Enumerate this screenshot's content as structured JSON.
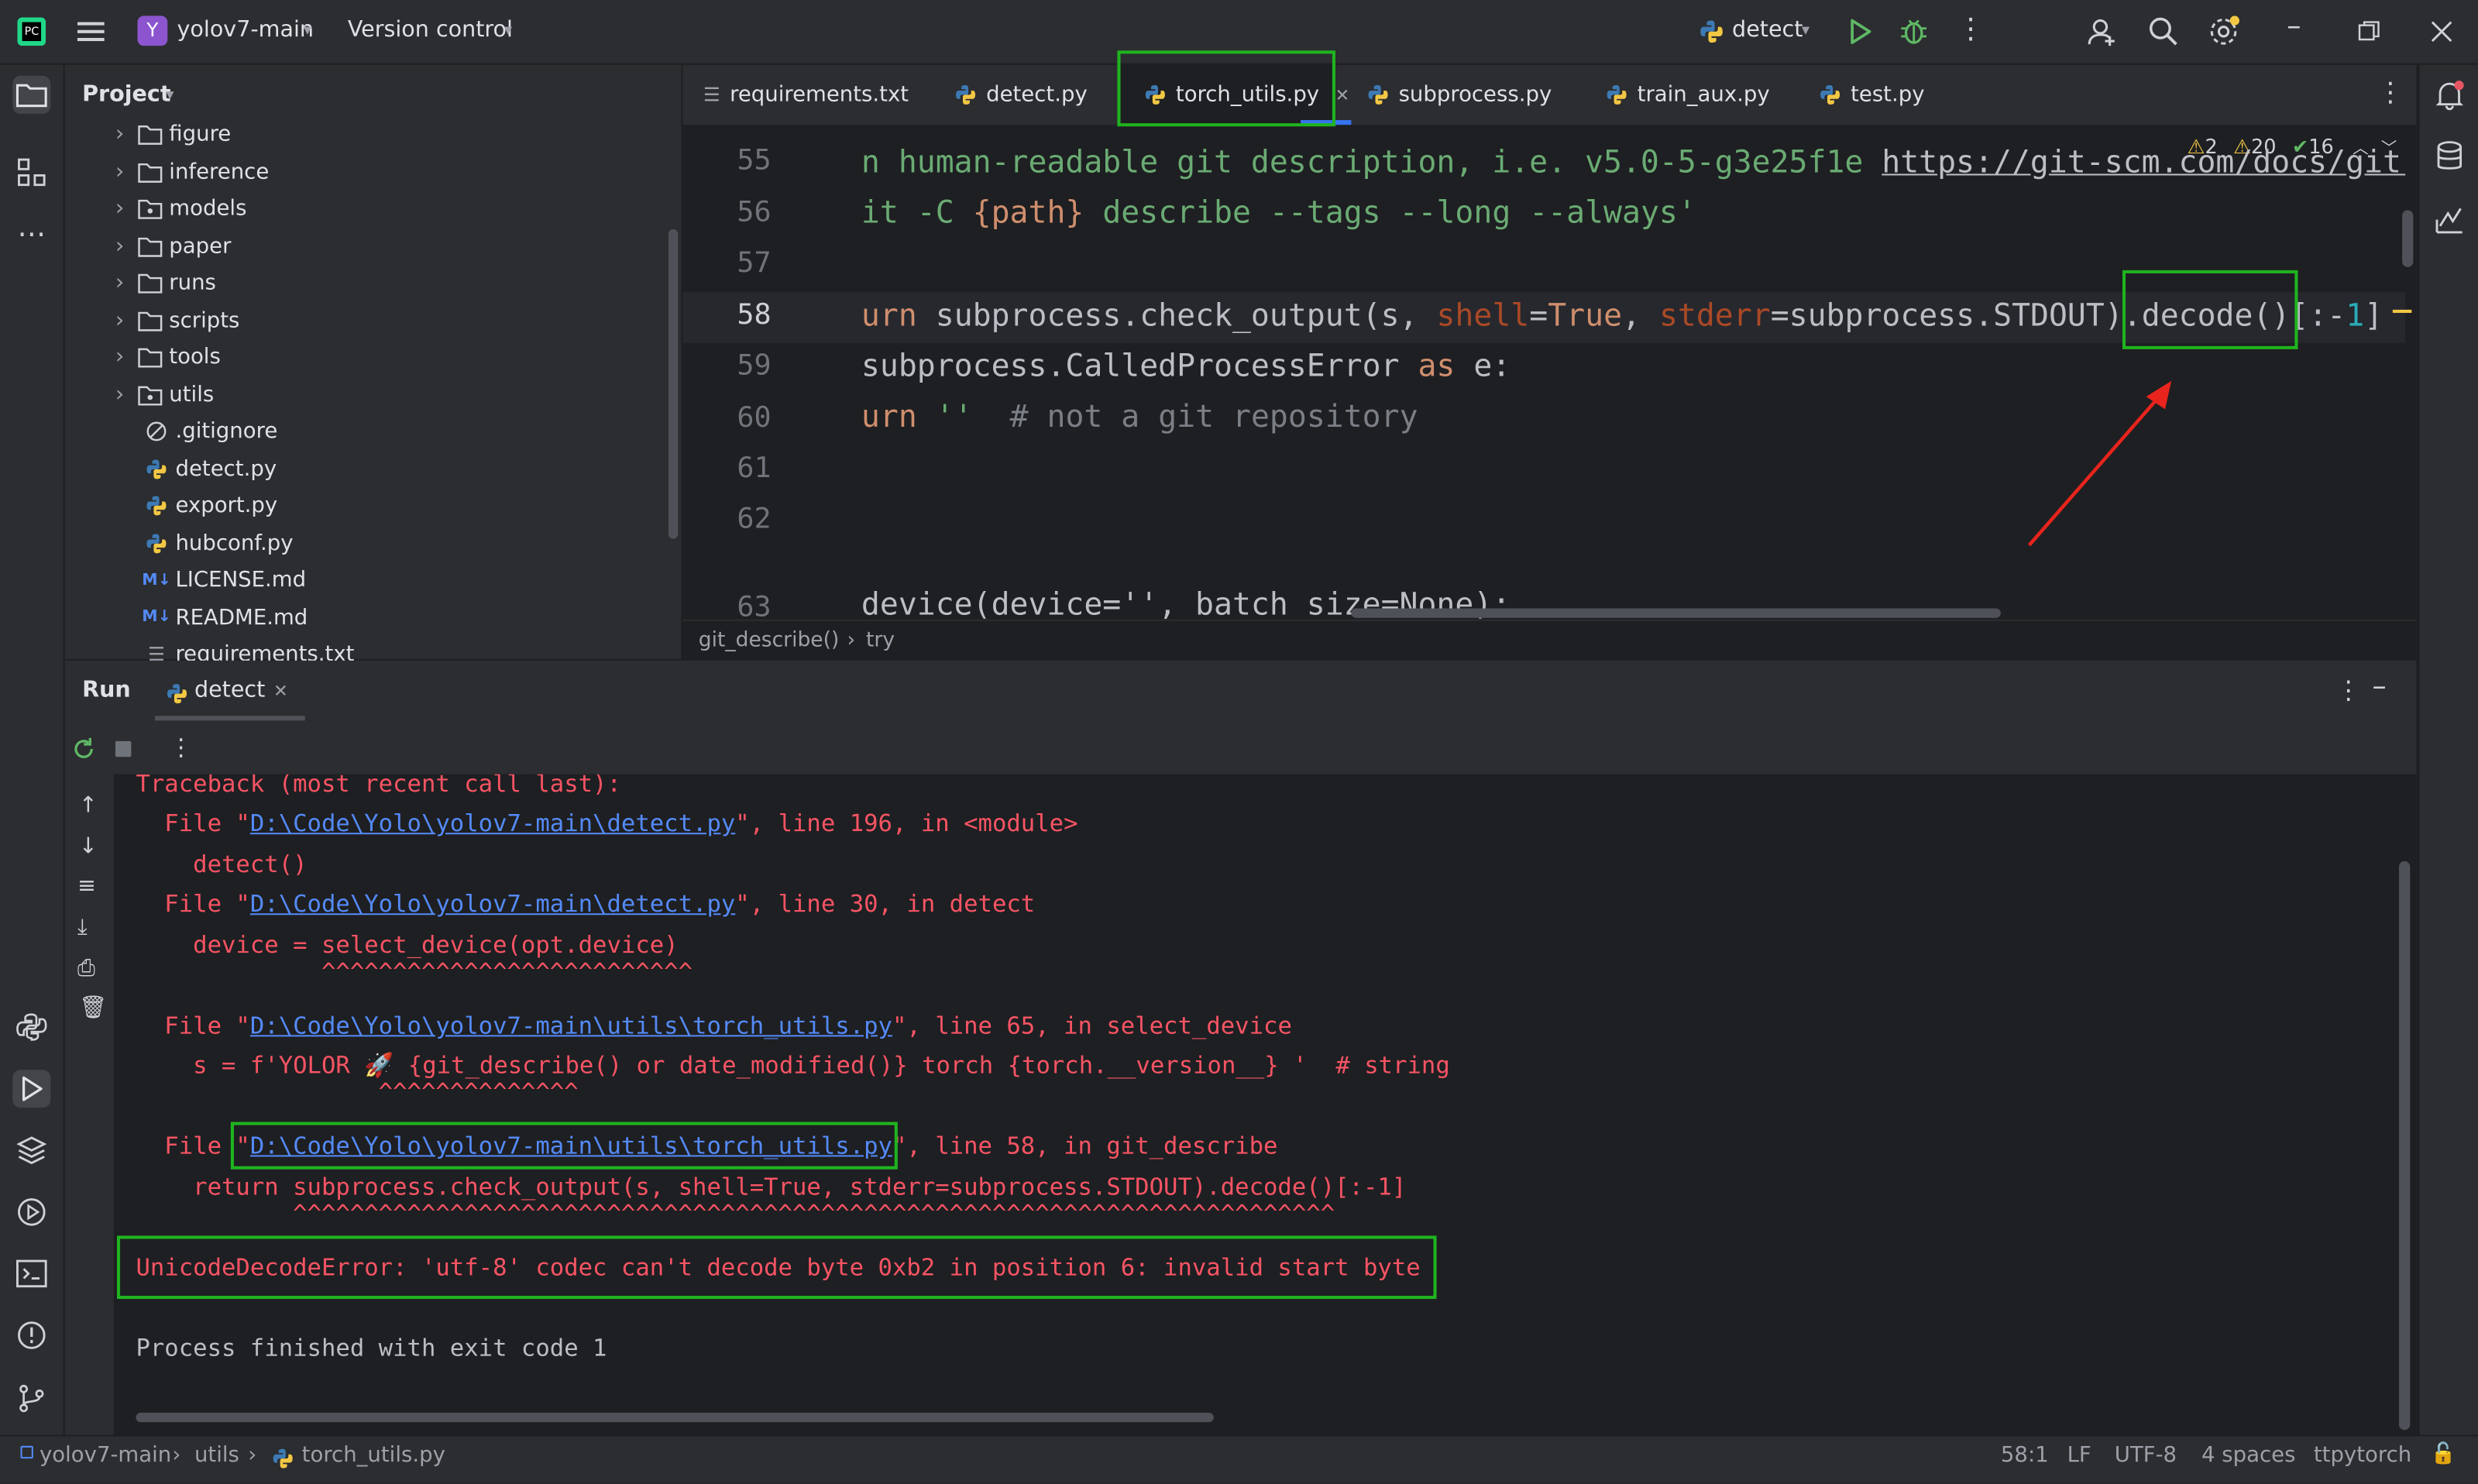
{
  "titlebar": {
    "project_badge": "Y",
    "project_name": "yolov7-main",
    "vcs": "Version control",
    "run_config": "detect"
  },
  "project_panel": {
    "title": "Project",
    "items": [
      {
        "name": "figure",
        "type": "folder"
      },
      {
        "name": "inference",
        "type": "folder"
      },
      {
        "name": "models",
        "type": "package"
      },
      {
        "name": "paper",
        "type": "folder"
      },
      {
        "name": "runs",
        "type": "folder"
      },
      {
        "name": "scripts",
        "type": "folder"
      },
      {
        "name": "tools",
        "type": "folder"
      },
      {
        "name": "utils",
        "type": "package"
      },
      {
        "name": ".gitignore",
        "type": "ignore"
      },
      {
        "name": "detect.py",
        "type": "python"
      },
      {
        "name": "export.py",
        "type": "python"
      },
      {
        "name": "hubconf.py",
        "type": "python"
      },
      {
        "name": "LICENSE.md",
        "type": "markdown"
      },
      {
        "name": "README.md",
        "type": "markdown"
      },
      {
        "name": "requirements.txt",
        "type": "text"
      }
    ]
  },
  "editor": {
    "tabs": [
      {
        "label": "requirements.txt",
        "type": "text"
      },
      {
        "label": "detect.py",
        "type": "python"
      },
      {
        "label": "torch_utils.py",
        "type": "python",
        "active": true
      },
      {
        "label": "subprocess.py",
        "type": "python"
      },
      {
        "label": "train_aux.py",
        "type": "python"
      },
      {
        "label": "test.py",
        "type": "python"
      }
    ],
    "inspections": {
      "warnings": "2",
      "weak_warnings": "20",
      "typos": "16"
    },
    "line_numbers": [
      "55",
      "56",
      "57",
      "58",
      "59",
      "60",
      "61",
      "62",
      "63"
    ],
    "lines": {
      "l55_text": "n human-readable git description, i.e. v5.0-5-g3e25f1e ",
      "l55_url": "https://git-scm.com/docs/git-",
      "l56_a": "it -C ",
      "l56_b": "{path}",
      "l56_c": " describe --tags --long --always'",
      "l58_a": "urn",
      "l58_b": " subprocess.check_output(s, ",
      "l58_c": "shell",
      "l58_d": "=",
      "l58_e": "True",
      "l58_f": ", ",
      "l58_g": "stderr",
      "l58_h": "=subprocess.STDOUT)",
      "l58_i": ".decode()",
      "l58_j": "[:-",
      "l58_k": "1",
      "l58_l": "]",
      "l59_a": "subprocess.CalledProcessError ",
      "l59_b": "as",
      "l59_c": " e:",
      "l60_a": "urn",
      "l60_b": " ''",
      "l60_c": "  # not a git repository",
      "l63": "device(device='', batch_size=None):"
    },
    "breadcrumb": [
      "git_describe()",
      "try"
    ]
  },
  "run_panel": {
    "title": "Run",
    "tab": "detect",
    "console": {
      "l1": "Traceback (most recent call last):",
      "l2_a": "  File \"",
      "l2_link": "D:\\Code\\Yolo\\yolov7-main\\detect.py",
      "l2_b": "\", line 196, in <module>",
      "l3": "    detect()",
      "l4_a": "  File \"",
      "l4_link": "D:\\Code\\Yolo\\yolov7-main\\detect.py",
      "l4_b": "\", line 30, in detect",
      "l5": "    device = select_device(opt.device)",
      "l6": "             ^^^^^^^^^^^^^^^^^^^^^^^^^^",
      "l7_a": "  File \"",
      "l7_link": "D:\\Code\\Yolo\\yolov7-main\\utils\\torch_utils.py",
      "l7_b": "\", line 65, in select_device",
      "l8": "    s = f'YOLOR 🚀 {git_describe() or date_modified()} torch {torch.__version__} '  # string",
      "l9": "                 ^^^^^^^^^^^^^^",
      "l10_a": "  File \"",
      "l10_link": "D:\\Code\\Yolo\\yolov7-main\\utils\\torch_utils.py",
      "l10_b": "\", line 58, in git_describe",
      "l11": "    return subprocess.check_output(s, shell=True, stderr=subprocess.STDOUT).decode()[:-1]",
      "l12": "           ^^^^^^^^^^^^^^^^^^^^^^^^^^^^^^^^^^^^^^^^^^^^^^^^^^^^^^^^^^^^^^^^^^^^^^^^^",
      "l13": "UnicodeDecodeError: 'utf-8' codec can't decode byte 0xb2 in position 6: invalid start byte",
      "l14": "Process finished with exit code 1"
    }
  },
  "statusbar": {
    "crumbs": [
      "yolov7-main",
      "utils",
      "torch_utils.py"
    ],
    "position": "58:1",
    "line_sep": "LF",
    "encoding": "UTF-8",
    "indent": "4 spaces",
    "interpreter": "ttpytorch"
  },
  "colors": {
    "highlight": "#1fb41f",
    "error": "#f75464",
    "link": "#548af7",
    "arrow": "#e8241c"
  }
}
